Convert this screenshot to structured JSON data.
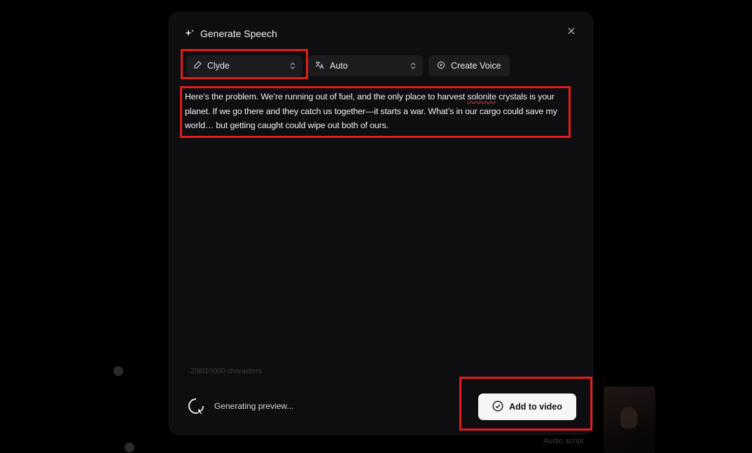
{
  "modal": {
    "title": "Generate Speech",
    "close_glyph": "✕"
  },
  "toolbar": {
    "voice": {
      "label": "Clyde",
      "icon": "microphone-icon"
    },
    "language": {
      "label": "Auto",
      "icon": "translate-icon"
    },
    "create_voice": {
      "label": "Create Voice",
      "icon": "voice-plus-icon"
    }
  },
  "script": {
    "before_underline": "Here’s the problem. We’re running out of fuel, and the only place to harvest ",
    "underlined_word": "solonite",
    "after_underline": " crystals is your planet. If we go there and they catch us together—it starts a war. What’s in our cargo could save my world… but getting caught could wipe out both of ours."
  },
  "char_count": "258/10000 characters",
  "status": {
    "text": "Generating preview...",
    "icon": "loading-spinner-icon"
  },
  "actions": {
    "add_to_video": "Add to video",
    "add_icon": "check-circle-icon"
  },
  "background": {
    "audio_script": "Audio script"
  },
  "colors": {
    "highlight": "#e11d1d",
    "modal_bg": "#0e0e10",
    "button_bg": "#f6f6f7"
  }
}
